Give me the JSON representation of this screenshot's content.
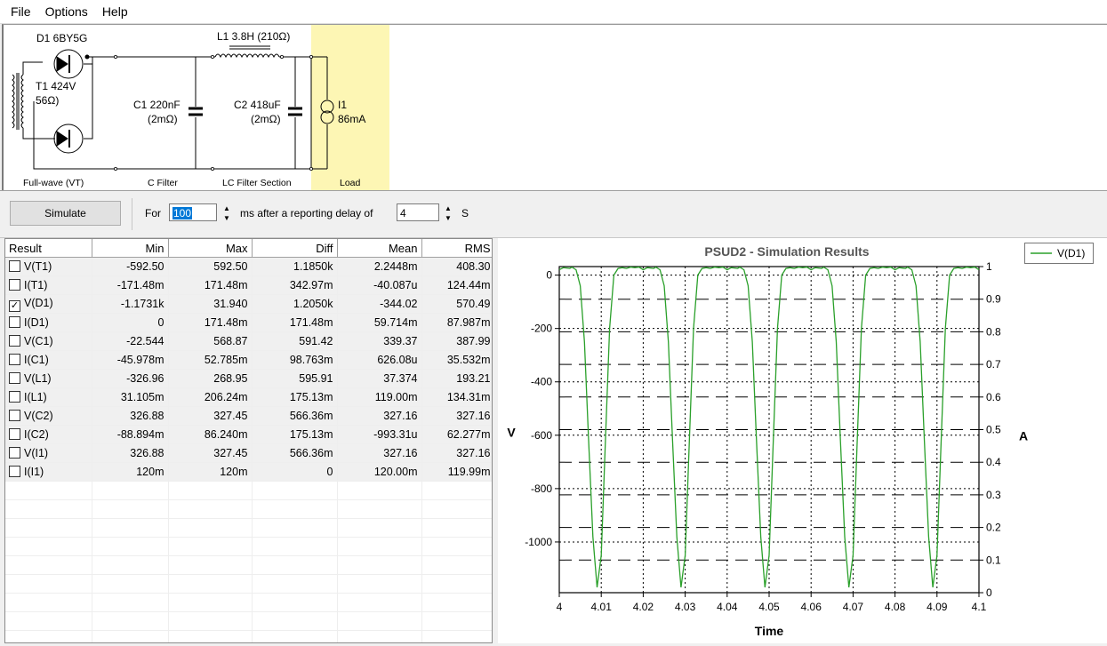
{
  "menu": [
    "File",
    "Options",
    "Help"
  ],
  "schematic": {
    "d1": "D1 6BY5G",
    "l1": "L1 3.8H (210Ω)",
    "t1_a": "T1 424V",
    "t1_b": "56Ω)",
    "c1_a": "C1 220nF",
    "c1_b": "(2mΩ)",
    "c2_a": "C2 418uF",
    "c2_b": "(2mΩ)",
    "i1_a": "I1",
    "i1_b": "86mA",
    "sec_rect": "Full-wave (VT)",
    "sec_c": "C Filter",
    "sec_lc": "LC Filter Section",
    "sec_load": "Load",
    "load_color": "#fdf6b4"
  },
  "toolbar": {
    "simulate": "Simulate",
    "for_label": "For",
    "for_value": "100",
    "ms_label": "ms  after a reporting delay of",
    "delay_value": "4",
    "s_label": "S"
  },
  "results": {
    "headers": [
      "Result",
      "Min",
      "Max",
      "Diff",
      "Mean",
      "RMS"
    ],
    "rows": [
      {
        "name": "V(T1)",
        "checked": false,
        "min": "-592.50",
        "max": "592.50",
        "diff": "1.1850k",
        "mean": "2.2448m",
        "rms": "408.30"
      },
      {
        "name": "I(T1)",
        "checked": false,
        "min": "-171.48m",
        "max": "171.48m",
        "diff": "342.97m",
        "mean": "-40.087u",
        "rms": "124.44m"
      },
      {
        "name": "V(D1)",
        "checked": true,
        "min": "-1.1731k",
        "max": "31.940",
        "diff": "1.2050k",
        "mean": "-344.02",
        "rms": "570.49"
      },
      {
        "name": "I(D1)",
        "checked": false,
        "min": "0",
        "max": "171.48m",
        "diff": "171.48m",
        "mean": "59.714m",
        "rms": "87.987m"
      },
      {
        "name": "V(C1)",
        "checked": false,
        "min": "-22.544",
        "max": "568.87",
        "diff": "591.42",
        "mean": "339.37",
        "rms": "387.99"
      },
      {
        "name": "I(C1)",
        "checked": false,
        "min": "-45.978m",
        "max": "52.785m",
        "diff": "98.763m",
        "mean": "626.08u",
        "rms": "35.532m"
      },
      {
        "name": "V(L1)",
        "checked": false,
        "min": "-326.96",
        "max": "268.95",
        "diff": "595.91",
        "mean": "37.374",
        "rms": "193.21"
      },
      {
        "name": "I(L1)",
        "checked": false,
        "min": "31.105m",
        "max": "206.24m",
        "diff": "175.13m",
        "mean": "119.00m",
        "rms": "134.31m"
      },
      {
        "name": "V(C2)",
        "checked": false,
        "min": "326.88",
        "max": "327.45",
        "diff": "566.36m",
        "mean": "327.16",
        "rms": "327.16"
      },
      {
        "name": "I(C2)",
        "checked": false,
        "min": "-88.894m",
        "max": "86.240m",
        "diff": "175.13m",
        "mean": "-993.31u",
        "rms": "62.277m"
      },
      {
        "name": "V(I1)",
        "checked": false,
        "min": "326.88",
        "max": "327.45",
        "diff": "566.36m",
        "mean": "327.16",
        "rms": "327.16"
      },
      {
        "name": "I(I1)",
        "checked": false,
        "min": "120m",
        "max": "120m",
        "diff": "0",
        "mean": "120.00m",
        "rms": "119.99m"
      }
    ],
    "empty_rows": 9
  },
  "chart_data": {
    "type": "line",
    "title": "PSUD2 - Simulation Results",
    "xlabel": "Time",
    "ylabel": "V",
    "y2label": "A",
    "xlim": [
      4,
      4.1
    ],
    "ylim": [
      -1190,
      32
    ],
    "y2lim": [
      0,
      1
    ],
    "xticks": [
      "4",
      "4.01",
      "4.02",
      "4.03",
      "4.04",
      "4.05",
      "4.06",
      "4.07",
      "4.08",
      "4.09",
      "4.1"
    ],
    "yticks": [
      0,
      -200,
      -400,
      -600,
      -800,
      -1000
    ],
    "y2ticks": [
      "0",
      "0.1",
      "0.2",
      "0.3",
      "0.4",
      "0.5",
      "0.6",
      "0.7",
      "0.8",
      "0.9",
      "1"
    ],
    "grid": true,
    "legend_position": "outside-top-right",
    "series": [
      {
        "name": "V(D1)",
        "color": "#2aa02a",
        "x": [
          4.0,
          4.001,
          4.0025,
          4.003,
          4.004,
          4.005,
          4.006,
          4.007,
          4.008,
          4.009,
          4.01,
          4.011,
          4.012,
          4.013,
          4.014,
          4.015,
          4.016,
          4.017,
          4.018,
          4.019,
          4.02,
          4.021,
          4.0225,
          4.023,
          4.024,
          4.025,
          4.026,
          4.027,
          4.028,
          4.029,
          4.03,
          4.031,
          4.032,
          4.033,
          4.034,
          4.035,
          4.036,
          4.037,
          4.038,
          4.039,
          4.04,
          4.041,
          4.0425,
          4.043,
          4.044,
          4.045,
          4.046,
          4.047,
          4.048,
          4.049,
          4.05,
          4.051,
          4.052,
          4.053,
          4.054,
          4.055,
          4.056,
          4.057,
          4.058,
          4.059,
          4.06,
          4.061,
          4.0625,
          4.063,
          4.064,
          4.065,
          4.066,
          4.067,
          4.068,
          4.069,
          4.07,
          4.071,
          4.072,
          4.073,
          4.074,
          4.075,
          4.076,
          4.077,
          4.078,
          4.079,
          4.08,
          4.081,
          4.0825,
          4.083,
          4.084,
          4.085,
          4.086,
          4.087,
          4.088,
          4.089,
          4.09,
          4.091,
          4.092,
          4.093,
          4.094,
          4.095,
          4.096,
          4.097,
          4.098,
          4.099,
          4.1
        ],
        "y": [
          20,
          28,
          25,
          30,
          20,
          -40,
          -250,
          -620,
          -980,
          -1170,
          -1050,
          -620,
          -200,
          0,
          25,
          28,
          25,
          30,
          28,
          30,
          20,
          28,
          25,
          30,
          20,
          -40,
          -250,
          -620,
          -980,
          -1170,
          -1050,
          -620,
          -200,
          0,
          25,
          28,
          25,
          30,
          28,
          30,
          20,
          28,
          25,
          30,
          20,
          -40,
          -250,
          -620,
          -980,
          -1170,
          -1050,
          -620,
          -200,
          0,
          25,
          28,
          25,
          30,
          28,
          30,
          20,
          28,
          25,
          30,
          20,
          -40,
          -250,
          -620,
          -980,
          -1170,
          -1050,
          -620,
          -200,
          0,
          25,
          28,
          25,
          30,
          28,
          30,
          20,
          28,
          25,
          30,
          20,
          -40,
          -250,
          -620,
          -980,
          -1170,
          -1050,
          -620,
          -200,
          0,
          25,
          28,
          25,
          30,
          28,
          30,
          20
        ]
      }
    ]
  }
}
